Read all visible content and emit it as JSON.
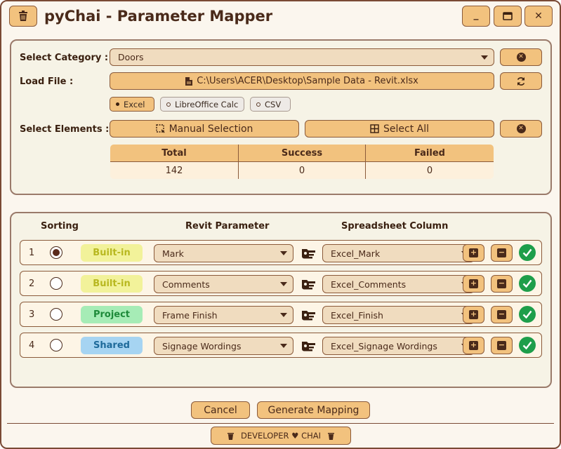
{
  "app": {
    "title": "pyChai - Parameter Mapper"
  },
  "controls": {
    "minimize_icon": "_",
    "maximize_icon": "□",
    "close_icon": "✕"
  },
  "settings": {
    "select_category_label": "Select Category :",
    "category_value": "Doors",
    "load_file_label": "Load File :",
    "file_path": "C:\\Users\\ACER\\Desktop\\Sample Data - Revit.xlsx",
    "formats": [
      {
        "label": "Excel",
        "selected": true
      },
      {
        "label": "LibreOffice Calc",
        "selected": false
      },
      {
        "label": "CSV",
        "selected": false
      }
    ],
    "select_elements_label": "Select Elements :",
    "manual_selection_label": "Manual Selection",
    "select_all_label": "Select All"
  },
  "stats": {
    "headers": [
      "Total",
      "Success",
      "Failed"
    ],
    "values": [
      "142",
      "0",
      "0"
    ]
  },
  "mapping": {
    "headers": {
      "sorting": "Sorting",
      "revit_parameter": "Revit Parameter",
      "spreadsheet_column": "Spreadsheet Column"
    },
    "rows": [
      {
        "index": "1",
        "selected": true,
        "type": "Built-in",
        "type_color": "#f2f29a",
        "type_text_color": "#b8b820",
        "parameter": "Mark",
        "column": "Excel_Mark"
      },
      {
        "index": "2",
        "selected": false,
        "type": "Built-in",
        "type_color": "#f2f29a",
        "type_text_color": "#b8b820",
        "parameter": "Comments",
        "column": "Excel_Comments"
      },
      {
        "index": "3",
        "selected": false,
        "type": "Project",
        "type_color": "#a6ecb6",
        "type_text_color": "#1e8a3a",
        "parameter": "Frame Finish",
        "column": "Excel_Finish"
      },
      {
        "index": "4",
        "selected": false,
        "type": "Shared",
        "type_color": "#a6d4f2",
        "type_text_color": "#1e6a9a",
        "parameter": "Signage Wordings",
        "column": "Excel_Signage Wordings"
      }
    ]
  },
  "actions": {
    "cancel_label": "Cancel",
    "generate_label": "Generate Mapping"
  },
  "footer": {
    "label": "DEVELOPER ♥ CHAI"
  },
  "colors": {
    "accent": "#f2c27e",
    "border": "#8a5a3a",
    "success": "#1e9e4a"
  }
}
